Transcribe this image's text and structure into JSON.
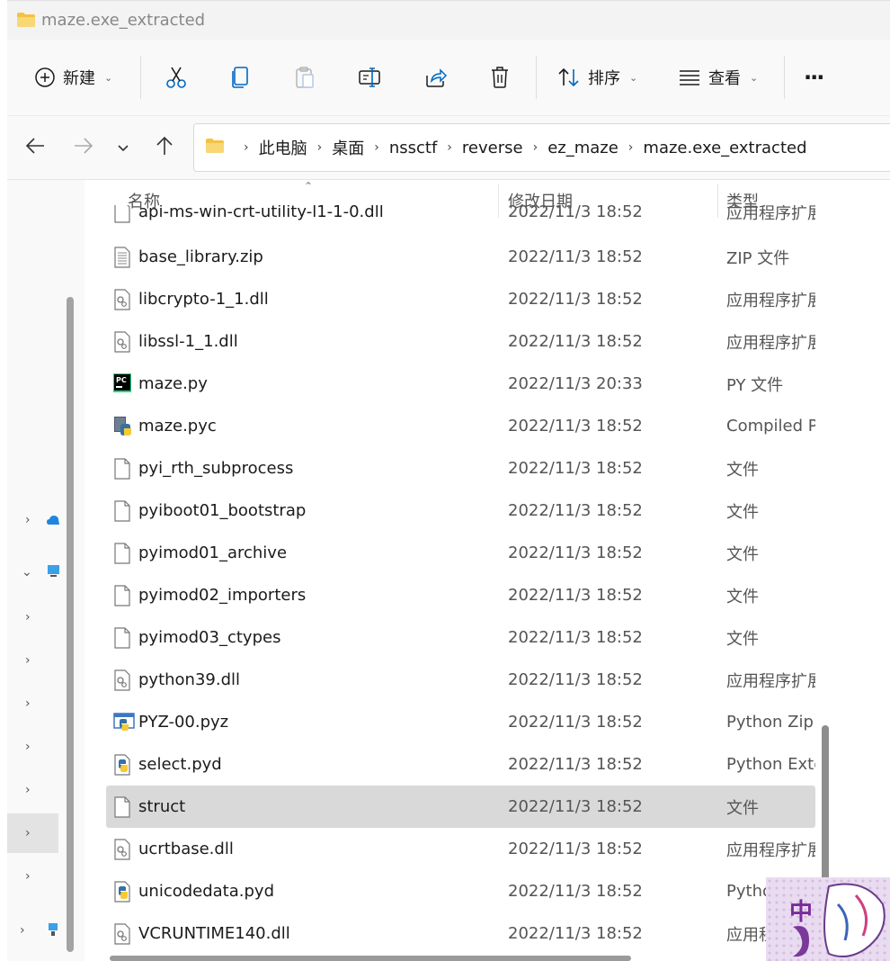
{
  "window": {
    "title": "maze.exe_extracted"
  },
  "toolbar": {
    "new_label": "新建",
    "sort_label": "排序",
    "view_label": "查看",
    "more_label": "···"
  },
  "address": {
    "crumbs": [
      "此电脑",
      "桌面",
      "nssctf",
      "reverse",
      "ez_maze",
      "maze.exe_extracted"
    ]
  },
  "columns": {
    "name": "名称",
    "date": "修改日期",
    "type": "类型"
  },
  "partial_row": {
    "name": "api-ms-win-crt-utility-l1-1-0.dll",
    "date": "2022/11/3 18:52",
    "type": "应用程序扩展"
  },
  "files": [
    {
      "name": "base_library.zip",
      "date": "2022/11/3 18:52",
      "type": "ZIP 文件",
      "icon": "zip-file-icon"
    },
    {
      "name": "libcrypto-1_1.dll",
      "date": "2022/11/3 18:52",
      "type": "应用程序扩展",
      "icon": "dll-file-icon"
    },
    {
      "name": "libssl-1_1.dll",
      "date": "2022/11/3 18:52",
      "type": "应用程序扩展",
      "icon": "dll-file-icon"
    },
    {
      "name": "maze.py",
      "date": "2022/11/3 20:33",
      "type": "PY 文件",
      "icon": "pycharm-file-icon"
    },
    {
      "name": "maze.pyc",
      "date": "2022/11/3 18:52",
      "type": "Compiled Python",
      "icon": "python-compiled-icon"
    },
    {
      "name": "pyi_rth_subprocess",
      "date": "2022/11/3 18:52",
      "type": "文件",
      "icon": "blank-file-icon"
    },
    {
      "name": "pyiboot01_bootstrap",
      "date": "2022/11/3 18:52",
      "type": "文件",
      "icon": "blank-file-icon"
    },
    {
      "name": "pyimod01_archive",
      "date": "2022/11/3 18:52",
      "type": "文件",
      "icon": "blank-file-icon"
    },
    {
      "name": "pyimod02_importers",
      "date": "2022/11/3 18:52",
      "type": "文件",
      "icon": "blank-file-icon"
    },
    {
      "name": "pyimod03_ctypes",
      "date": "2022/11/3 18:52",
      "type": "文件",
      "icon": "blank-file-icon"
    },
    {
      "name": "python39.dll",
      "date": "2022/11/3 18:52",
      "type": "应用程序扩展",
      "icon": "dll-file-icon"
    },
    {
      "name": "PYZ-00.pyz",
      "date": "2022/11/3 18:52",
      "type": "Python Zip",
      "icon": "python-zip-icon"
    },
    {
      "name": "select.pyd",
      "date": "2022/11/3 18:52",
      "type": "Python Extension",
      "icon": "python-file-icon"
    },
    {
      "name": "struct",
      "date": "2022/11/3 18:52",
      "type": "文件",
      "icon": "blank-file-icon",
      "selected": true
    },
    {
      "name": "ucrtbase.dll",
      "date": "2022/11/3 18:52",
      "type": "应用程序扩展",
      "icon": "dll-file-icon"
    },
    {
      "name": "unicodedata.pyd",
      "date": "2022/11/3 18:52",
      "type": "Python Extension",
      "icon": "python-file-icon"
    },
    {
      "name": "VCRUNTIME140.dll",
      "date": "2022/11/3 18:52",
      "type": "应用程序扩展",
      "icon": "dll-file-icon"
    }
  ],
  "overlay": {
    "char": "中"
  },
  "colors": {
    "selected_row": "#d9d9d9",
    "folder": "#f3c242",
    "accent": "#0067c0"
  }
}
